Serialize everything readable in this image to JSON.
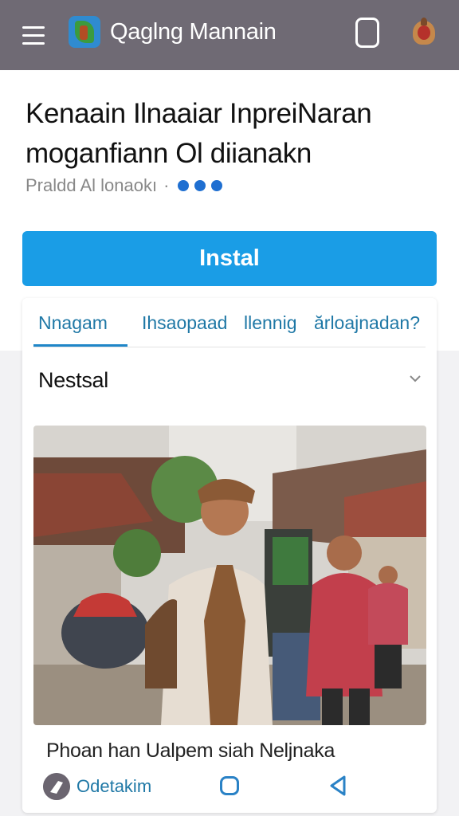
{
  "header": {
    "app_title": "Qaglng Mannain",
    "menu_icon": "menu-icon",
    "app_icon": "app-logo-icon",
    "phone_icon": "phone-icon",
    "crest_icon": "emblem-icon",
    "bar_color": "#6f6a74"
  },
  "article": {
    "headline_line1": "Kenaain Ilnaaiar InpreiNaran",
    "headline_line2": "moganfiann Ol diianakn",
    "meta_author": "Praldd Al lonaokı",
    "meta_separator": "·"
  },
  "install": {
    "label": "Instal",
    "color": "#1a9de6"
  },
  "tabs": [
    {
      "label": "Nnagam"
    },
    {
      "label": "Ihsaopaad"
    },
    {
      "label": "llennig"
    },
    {
      "label": "ărloajnadan?"
    }
  ],
  "section": {
    "title": "Nestsal",
    "chevron_icon": "chevron-down-icon"
  },
  "photo": {
    "caption": "Phoan han Ualpem siah Neljnaka"
  },
  "footer": {
    "author_name": "Odetakim",
    "home_icon": "home-square-icon",
    "back_icon": "back-triangle-icon"
  }
}
